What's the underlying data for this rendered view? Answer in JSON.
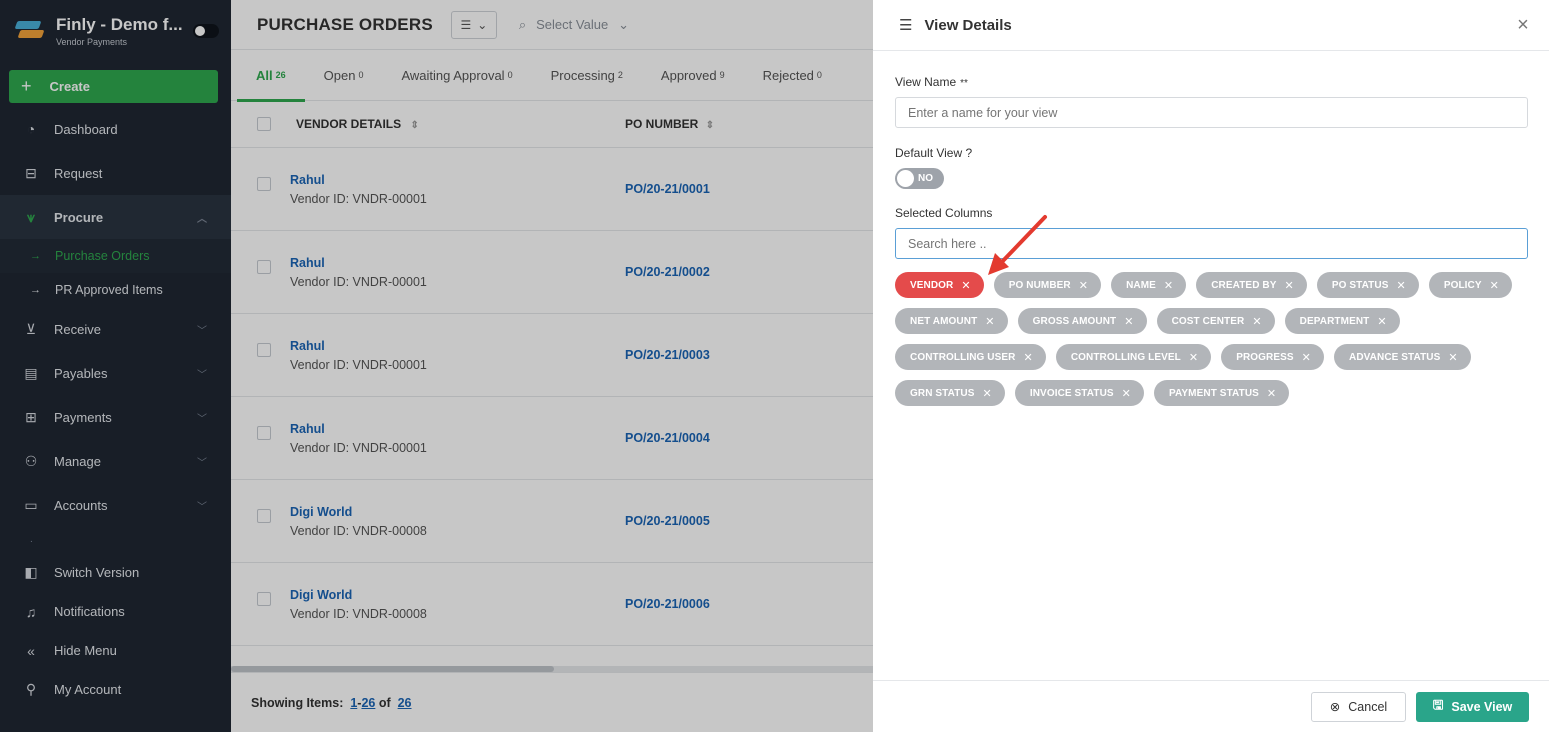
{
  "brand": {
    "title": "Finly - Demo f...",
    "subtitle": "Vendor Payments"
  },
  "create_label": "Create",
  "nav": {
    "dashboard": "Dashboard",
    "request": "Request",
    "procure": "Procure",
    "purchase_orders": "Purchase Orders",
    "pr_approved": "PR Approved Items",
    "receive": "Receive",
    "payables": "Payables",
    "payments": "Payments",
    "manage": "Manage",
    "accounts": "Accounts",
    "dot": ".",
    "switch_version": "Switch Version",
    "notifications": "Notifications",
    "hide_menu": "Hide Menu",
    "my_account": "My Account"
  },
  "main": {
    "title": "PURCHASE ORDERS",
    "select_value": "Select Value",
    "tabs": [
      {
        "label": "All",
        "count": "26"
      },
      {
        "label": "Open",
        "count": "0"
      },
      {
        "label": "Awaiting Approval",
        "count": "0"
      },
      {
        "label": "Processing",
        "count": "2"
      },
      {
        "label": "Approved",
        "count": "9"
      },
      {
        "label": "Rejected",
        "count": "0"
      }
    ],
    "columns": {
      "vendor": "VENDOR DETAILS",
      "po": "PO NUMBER"
    },
    "rows": [
      {
        "vendor": "Rahul",
        "vendor_id": "Vendor ID: VNDR-00001",
        "po": "PO/20-21/0001"
      },
      {
        "vendor": "Rahul",
        "vendor_id": "Vendor ID: VNDR-00001",
        "po": "PO/20-21/0002"
      },
      {
        "vendor": "Rahul",
        "vendor_id": "Vendor ID: VNDR-00001",
        "po": "PO/20-21/0003"
      },
      {
        "vendor": "Rahul",
        "vendor_id": "Vendor ID: VNDR-00001",
        "po": "PO/20-21/0004"
      },
      {
        "vendor": "Digi World",
        "vendor_id": "Vendor ID: VNDR-00008",
        "po": "PO/20-21/0005"
      },
      {
        "vendor": "Digi World",
        "vendor_id": "Vendor ID: VNDR-00008",
        "po": "PO/20-21/0006"
      }
    ],
    "footer": {
      "label": "Showing Items:",
      "start": "1",
      "dash": "-",
      "end": "26",
      "of": "of",
      "total": "26"
    }
  },
  "drawer": {
    "title": "View Details",
    "close": "×",
    "view_name_label": "View Name",
    "view_name_req": "**",
    "view_name_placeholder": "Enter a name for your view",
    "default_view_label": "Default View ?",
    "default_toggle": "NO",
    "selected_columns_label": "Selected Columns",
    "search_placeholder": "Search here ..",
    "chips": [
      "VENDOR",
      "PO NUMBER",
      "NAME",
      "CREATED BY",
      "PO STATUS",
      "POLICY",
      "NET AMOUNT",
      "GROSS AMOUNT",
      "COST CENTER",
      "DEPARTMENT",
      "CONTROLLING USER",
      "CONTROLLING LEVEL",
      "PROGRESS",
      "ADVANCE STATUS",
      "GRN STATUS",
      "INVOICE STATUS",
      "PAYMENT STATUS"
    ],
    "cancel": "Cancel",
    "save": "Save View"
  },
  "colors": {
    "accent_green": "#2fa84f",
    "sidebar_bg": "#1f2733",
    "link_blue": "#1a64b5",
    "chip_selected": "#e44b4b",
    "save_btn": "#2aa58a"
  }
}
